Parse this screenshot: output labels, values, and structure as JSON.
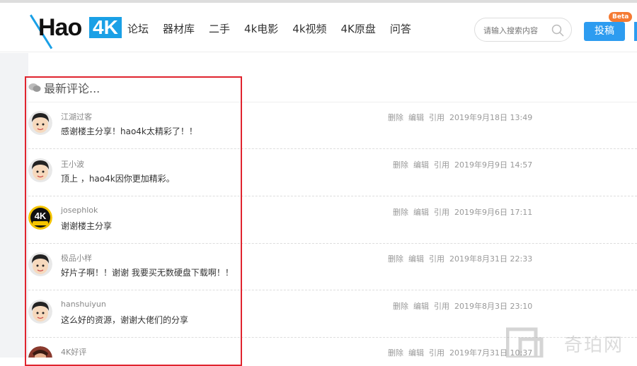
{
  "brand": {
    "logo_text": "Hao",
    "logo_badge": "4K"
  },
  "nav": [
    "论坛",
    "器材库",
    "二手",
    "4k电影",
    "4k视频",
    "4K原盘",
    "问答"
  ],
  "search": {
    "placeholder": "请输入搜索内容"
  },
  "post_button": {
    "label": "投稿",
    "badge": "Beta"
  },
  "section": {
    "title": "最新评论..."
  },
  "actions": {
    "delete": "删除",
    "edit": "编辑",
    "quote": "引用"
  },
  "comments": [
    {
      "author": "江湖过客",
      "text": "感谢楼主分享！hao4k太精彩了！！",
      "time": "2019年9月18日 13:49",
      "avatar": "cartoon-face"
    },
    {
      "author": "王小波",
      "text": "顶上 ，hao4k因你更加精彩。",
      "time": "2019年9月9日 14:57",
      "avatar": "cartoon-face"
    },
    {
      "author": "josephlok",
      "text": "谢谢楼主分享",
      "time": "2019年9月6日 17:11",
      "avatar": "4k-logo"
    },
    {
      "author": "极品小样",
      "text": "好片子啊！！谢谢 我要买无数硬盘下载啊！！",
      "time": "2019年8月31日 22:33",
      "avatar": "cartoon-face"
    },
    {
      "author": "hanshuiyun",
      "text": "这么好的资源，谢谢大佬们的分享",
      "time": "2019年8月3日 23:10",
      "avatar": "cartoon-face"
    },
    {
      "author": "4K好评",
      "text": "",
      "time": "2019年7月31日 10:37",
      "avatar": "photo"
    }
  ],
  "watermark": {
    "text": "奇珀网"
  },
  "colors": {
    "brand_blue": "#1aa0e6",
    "button_blue": "#2d9cf0",
    "beta_orange": "#f57a32",
    "highlight_red": "#e0242e"
  }
}
